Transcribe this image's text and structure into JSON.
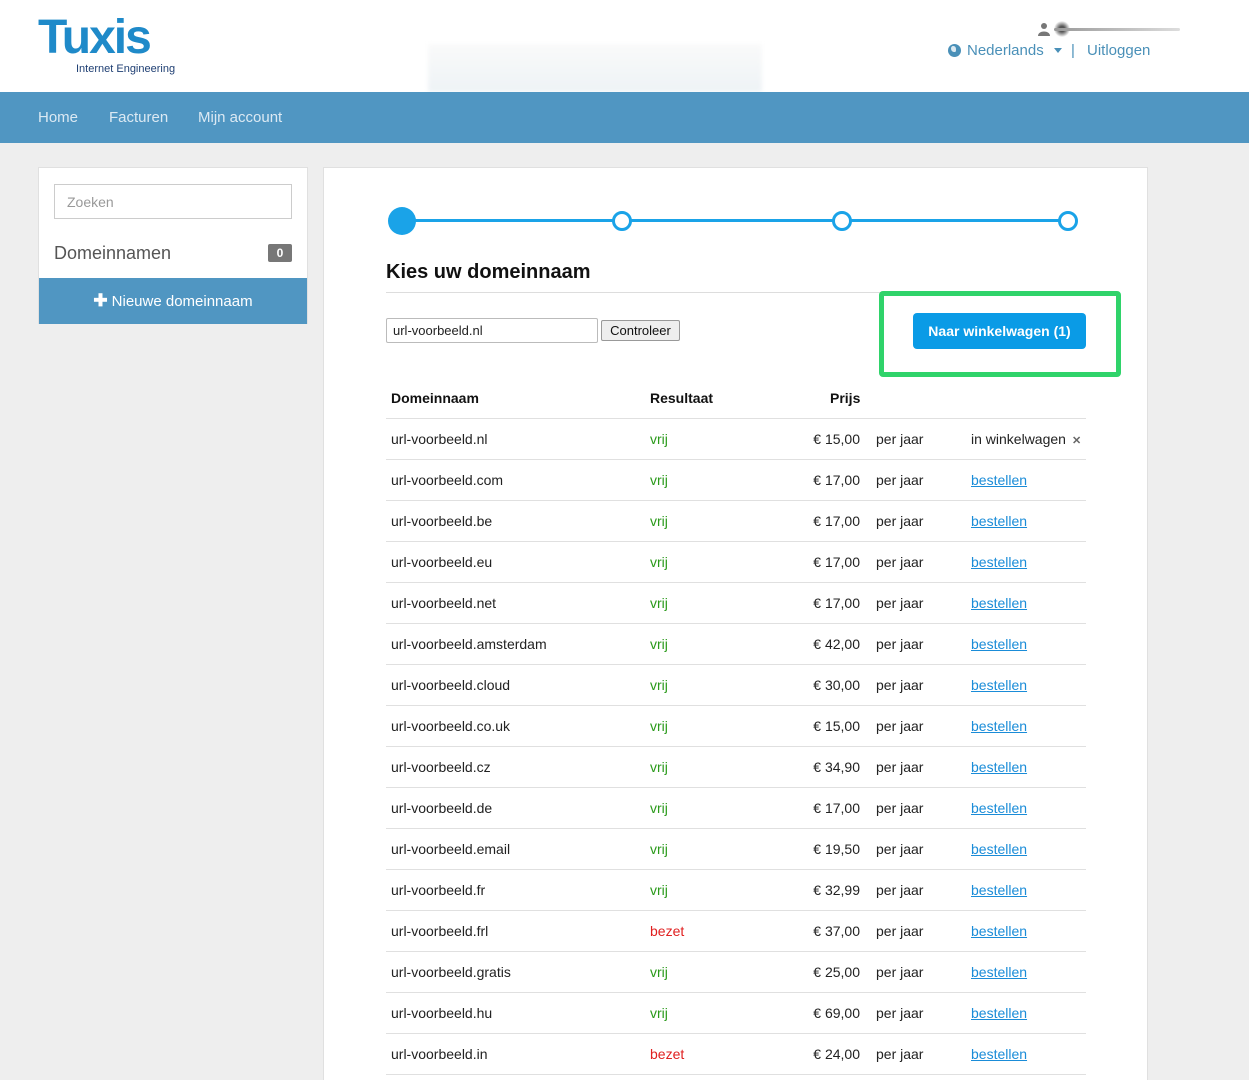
{
  "header": {
    "logo_text": "Tuxis",
    "logo_tagline": "Internet Engineering",
    "language": "Nederlands",
    "separator": "|",
    "logout": "Uitloggen"
  },
  "nav": {
    "items": [
      "Home",
      "Facturen",
      "Mijn account"
    ]
  },
  "sidebar": {
    "search_placeholder": "Zoeken",
    "section_label": "Domeinnamen",
    "count": "0",
    "new_button": "Nieuwe domeinnaam"
  },
  "stepper": {
    "total_steps": 4,
    "current_step": 1
  },
  "main": {
    "title": "Kies uw domeinnaam",
    "input_value": "url-voorbeeld.nl",
    "check_button": "Controleer",
    "cart_button": "Naar winkelwagen (1)"
  },
  "table": {
    "headers": {
      "domain": "Domeinnaam",
      "result": "Resultaat",
      "price": "Prijs"
    },
    "rows": [
      {
        "domain": "url-voorbeeld.nl",
        "result": "vrij",
        "price": "€ 15,00",
        "period": "per jaar",
        "action": "in winkelwagen",
        "in_cart": true
      },
      {
        "domain": "url-voorbeeld.com",
        "result": "vrij",
        "price": "€ 17,00",
        "period": "per jaar",
        "action": "bestellen"
      },
      {
        "domain": "url-voorbeeld.be",
        "result": "vrij",
        "price": "€ 17,00",
        "period": "per jaar",
        "action": "bestellen"
      },
      {
        "domain": "url-voorbeeld.eu",
        "result": "vrij",
        "price": "€ 17,00",
        "period": "per jaar",
        "action": "bestellen"
      },
      {
        "domain": "url-voorbeeld.net",
        "result": "vrij",
        "price": "€ 17,00",
        "period": "per jaar",
        "action": "bestellen"
      },
      {
        "domain": "url-voorbeeld.amsterdam",
        "result": "vrij",
        "price": "€ 42,00",
        "period": "per jaar",
        "action": "bestellen"
      },
      {
        "domain": "url-voorbeeld.cloud",
        "result": "vrij",
        "price": "€ 30,00",
        "period": "per jaar",
        "action": "bestellen"
      },
      {
        "domain": "url-voorbeeld.co.uk",
        "result": "vrij",
        "price": "€ 15,00",
        "period": "per jaar",
        "action": "bestellen"
      },
      {
        "domain": "url-voorbeeld.cz",
        "result": "vrij",
        "price": "€ 34,90",
        "period": "per jaar",
        "action": "bestellen"
      },
      {
        "domain": "url-voorbeeld.de",
        "result": "vrij",
        "price": "€ 17,00",
        "period": "per jaar",
        "action": "bestellen"
      },
      {
        "domain": "url-voorbeeld.email",
        "result": "vrij",
        "price": "€ 19,50",
        "period": "per jaar",
        "action": "bestellen"
      },
      {
        "domain": "url-voorbeeld.fr",
        "result": "vrij",
        "price": "€ 32,99",
        "period": "per jaar",
        "action": "bestellen"
      },
      {
        "domain": "url-voorbeeld.frl",
        "result": "bezet",
        "price": "€ 37,00",
        "period": "per jaar",
        "action": "bestellen"
      },
      {
        "domain": "url-voorbeeld.gratis",
        "result": "vrij",
        "price": "€ 25,00",
        "period": "per jaar",
        "action": "bestellen"
      },
      {
        "domain": "url-voorbeeld.hu",
        "result": "vrij",
        "price": "€ 69,00",
        "period": "per jaar",
        "action": "bestellen"
      },
      {
        "domain": "url-voorbeeld.in",
        "result": "bezet",
        "price": "€ 24,00",
        "period": "per jaar",
        "action": "bestellen"
      }
    ]
  },
  "colors": {
    "nav": "#5096c2",
    "accent": "#1aa3e8",
    "button": "#0a9be6",
    "highlight": "#2fd36a",
    "free": "#2a9a1a",
    "taken": "#e02020"
  },
  "icons": [
    "user-icon",
    "globe-icon",
    "chevron-down-icon",
    "plus-icon",
    "close-icon"
  ]
}
